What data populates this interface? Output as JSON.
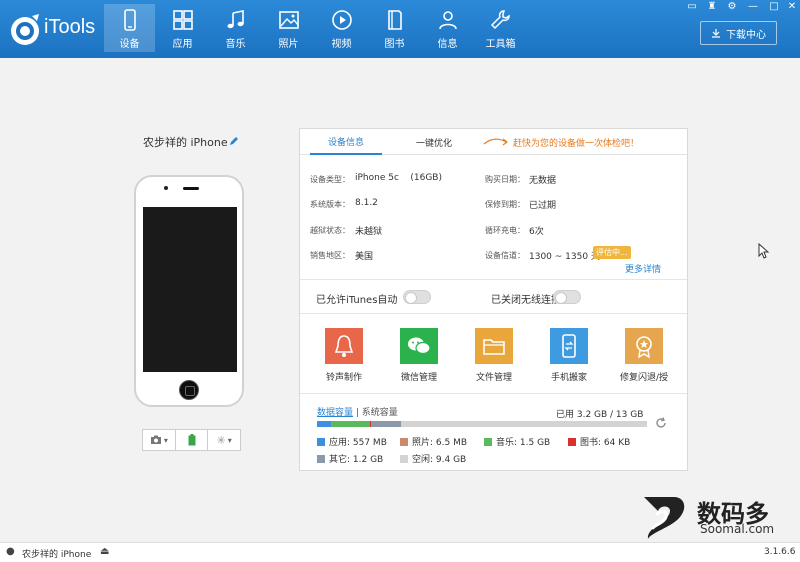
{
  "app": {
    "logo_text": "iTools",
    "download_center_label": "下载中心"
  },
  "nav": [
    {
      "label": "设备",
      "icon": "device-icon",
      "active": true
    },
    {
      "label": "应用",
      "icon": "apps-grid-icon",
      "active": false
    },
    {
      "label": "音乐",
      "icon": "music-note-icon",
      "active": false
    },
    {
      "label": "照片",
      "icon": "photo-icon",
      "active": false
    },
    {
      "label": "视频",
      "icon": "video-play-icon",
      "active": false
    },
    {
      "label": "图书",
      "icon": "book-icon",
      "active": false
    },
    {
      "label": "信息",
      "icon": "person-icon",
      "active": false
    },
    {
      "label": "工具箱",
      "icon": "wrench-icon",
      "active": false
    }
  ],
  "device": {
    "name": "农步祥的 iPhone"
  },
  "tabs": {
    "device_info": "设备信息",
    "optimize": "一键优化",
    "promo": "赶快为您的设备做一次体检吧！"
  },
  "info": {
    "model_label": "设备类型：",
    "model_value": "iPhone 5c    (16GB)",
    "version_label": "系统版本：",
    "version_value": "8.1.2",
    "jailbreak_label": "越狱状态：",
    "jailbreak_value": "未越狱",
    "region_label": "销售地区：",
    "region_value": "美国",
    "purchase_label": "购买日期：",
    "purchase_value": "无数据",
    "warranty_label": "保修到期：",
    "warranty_value": "已过期",
    "cycle_label": "循环充电：",
    "cycle_value": "6次",
    "signal_label": "设备信道：",
    "signal_value": "1300 ~ 1350 天",
    "cycle_tag": "评估中...",
    "more_link": "更多详情"
  },
  "toggles": {
    "itunes_label": "已允许iTunes自动",
    "wifi_label": "已关闭无线连接"
  },
  "apps": [
    {
      "label": "铃声制作",
      "icon": "bell-icon",
      "color": "#e8674a"
    },
    {
      "label": "微信管理",
      "icon": "wechat-icon",
      "color": "#2bb24c"
    },
    {
      "label": "文件管理",
      "icon": "folder-icon",
      "color": "#e9a73b"
    },
    {
      "label": "手机搬家",
      "icon": "phone-transfer-icon",
      "color": "#3f9be0"
    },
    {
      "label": "修复闪退/授",
      "icon": "medal-icon",
      "color": "#e6a64d"
    }
  ],
  "storage": {
    "tab_data": "数据容量",
    "tab_sep": " | ",
    "tab_system": "系统容量",
    "used": "已用 3.2 GB / 13 GB",
    "legend": [
      {
        "label": "应用: 557 MB",
        "color": "#3d8fe0",
        "fraction": 0.043
      },
      {
        "label": "照片: 6.5 MB",
        "color": "#c98a6a",
        "fraction": 0.002
      },
      {
        "label": "音乐: 1.5 GB",
        "color": "#5cb85c",
        "fraction": 0.115
      },
      {
        "label": "图书: 64 KB",
        "color": "#d9322c",
        "fraction": 0.001
      },
      {
        "label": "其它: 1.2 GB",
        "color": "#8a9aa8",
        "fraction": 0.092
      },
      {
        "label": "空闲: 9.4 GB",
        "color": "#d3d3d3",
        "fraction": 0.723
      }
    ]
  },
  "status": {
    "device": "农步祥的 iPhone",
    "version": "3.1.6.6"
  },
  "watermark": {
    "text": "数码多",
    "url": "Soomal.com"
  }
}
